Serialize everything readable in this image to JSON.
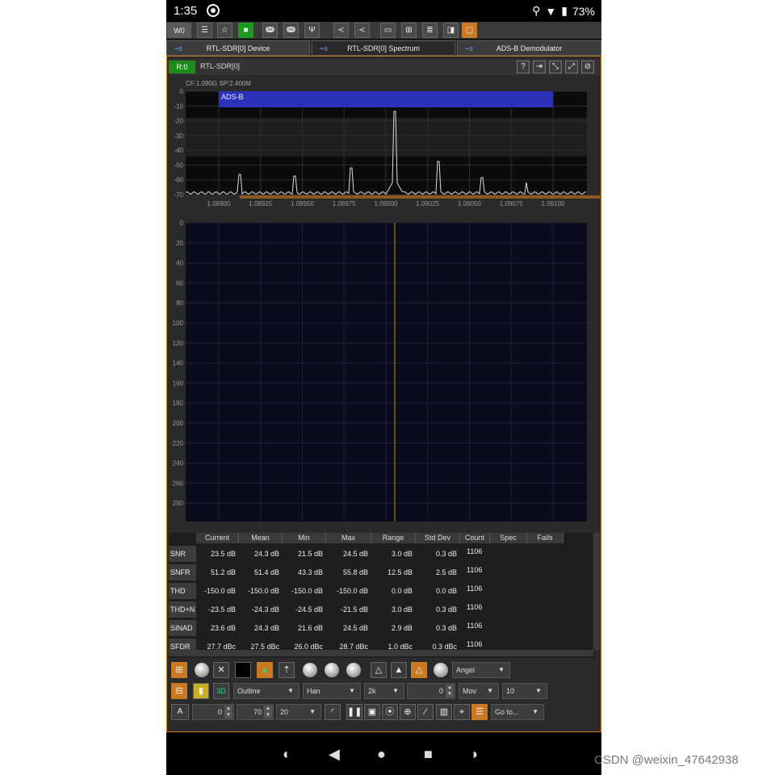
{
  "status": {
    "time": "1:35",
    "battery": "73%"
  },
  "toolbar": {
    "workspace": "W0"
  },
  "tabs": [
    {
      "label": "RTL-SDR[0] Device"
    },
    {
      "label": "RTL-SDR[0] Spectrum"
    },
    {
      "label": "ADS-B Demodulator"
    }
  ],
  "device": {
    "badge": "R:0",
    "name": "RTL-SDR[0]"
  },
  "spectrum": {
    "info": "CF:1.090G SP:2.400M",
    "channel_label": "ADS-B",
    "y_ticks": [
      "0",
      "-10",
      "-20",
      "-30",
      "-40",
      "-50",
      "-60",
      "-70"
    ],
    "x_ticks": [
      "1.08900",
      "1.08925",
      "1.08950",
      "1.08975",
      "1.09000",
      "1.09025",
      "1.09050",
      "1.09075",
      "1.09100"
    ]
  },
  "waterfall": {
    "y_ticks": [
      "0",
      "20",
      "40",
      "60",
      "80",
      "100",
      "120",
      "140",
      "160",
      "180",
      "200",
      "220",
      "240",
      "260",
      "280"
    ]
  },
  "table": {
    "columns": [
      "Current",
      "Mean",
      "Min",
      "Max",
      "Range",
      "Std Dev",
      "Count",
      "Spec",
      "Fails"
    ],
    "rows": [
      {
        "name": "SNR",
        "values": [
          "23.5 dB",
          "24.3 dB",
          "21.5 dB",
          "24.5 dB",
          "3.0 dB",
          "0.3 dB",
          "1106"
        ]
      },
      {
        "name": "SNFR",
        "values": [
          "51.2 dB",
          "51.4 dB",
          "43.3 dB",
          "55.8 dB",
          "12.5 dB",
          "2.5 dB",
          "1106"
        ]
      },
      {
        "name": "THD",
        "values": [
          "-150.0 dB",
          "-150.0 dB",
          "-150.0 dB",
          "-150.0 dB",
          "0.0 dB",
          "0.0 dB",
          "1106"
        ]
      },
      {
        "name": "THD+N",
        "values": [
          "-23.5 dB",
          "-24.3 dB",
          "-24.5 dB",
          "-21.5 dB",
          "3.0 dB",
          "0.3 dB",
          "1106"
        ]
      },
      {
        "name": "SINAD",
        "values": [
          "23.6 dB",
          "24.3 dB",
          "21.6 dB",
          "24.5 dB",
          "2.9 dB",
          "0.3 dB",
          "1106"
        ]
      },
      {
        "name": "SFDR",
        "values": [
          "27.7 dBc",
          "27.5 dBc",
          "26.0 dBc",
          "28.7 dBc",
          "1.0 dBc",
          "0.3 dBc",
          "1106"
        ]
      }
    ]
  },
  "controls": {
    "palette": "Angel",
    "style": "Outline",
    "window": "Han",
    "fft_size": "2k",
    "offset": "0",
    "avg_mode": "Mov",
    "avg_count": "10",
    "mode_button": "A",
    "min_value": "0",
    "max_value": "70",
    "rate": "20",
    "goto": "Go to...",
    "icon3d": "3D"
  },
  "watermark": "CSDN @weixin_47642938",
  "colors": {
    "accent": "#c97a22",
    "green": "#1c9a1c",
    "channel": "#2b31b8",
    "plot_bg": "#0b0b1e"
  }
}
